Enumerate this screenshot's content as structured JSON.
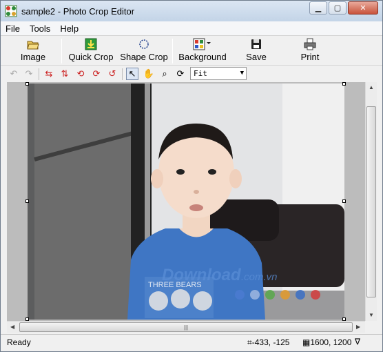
{
  "window": {
    "title": "sample2 - Photo Crop Editor"
  },
  "menu": [
    "File",
    "Tools",
    "Help"
  ],
  "toolbar": {
    "image": "Image",
    "quick_crop": "Quick Crop",
    "shape_crop": "Shape Crop",
    "background": "Background",
    "save": "Save",
    "print": "Print"
  },
  "zoom": {
    "value": "Fit"
  },
  "photo": {
    "watermark_main": "Download",
    "watermark_tld": ".com.vn",
    "shirt_text": "THREE BEARS"
  },
  "status": {
    "text": "Ready",
    "coords": "-433, -125",
    "size": "1600, 1200",
    "tail": "∇"
  },
  "icons": {
    "app": "photo-crop-app-icon",
    "image": "open-folder-icon",
    "quick_crop": "quick-crop-icon",
    "shape_crop": "shape-crop-icon",
    "background": "background-palette-icon",
    "save": "floppy-disk-icon",
    "print": "printer-icon"
  },
  "colors": {
    "title_bar": "#c3d4e7",
    "close_button": "#c8533c",
    "canvas": "#bcbcbc",
    "shirt": "#3f76c4"
  }
}
